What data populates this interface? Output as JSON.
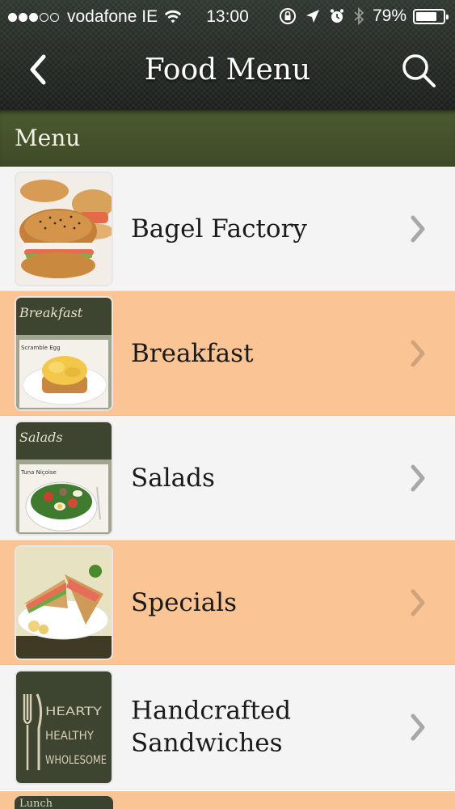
{
  "status_bar": {
    "carrier": "vodafone IE",
    "time": "13:00",
    "battery": "79%",
    "battery_level": 0.79
  },
  "nav": {
    "title": "Food Menu"
  },
  "section": {
    "label": "Menu"
  },
  "menu_items": [
    {
      "label": "Bagel Factory",
      "thumb_text": "",
      "bg": "#f4f4f4"
    },
    {
      "label": "Breakfast",
      "thumb_text": "Breakfast",
      "thumb_subtext": "Scramble Egg",
      "bg": "#fbc494"
    },
    {
      "label": "Salads",
      "thumb_text": "Salads",
      "thumb_subtext": "Tuna Niçoise",
      "bg": "#f4f4f4"
    },
    {
      "label": "Specials",
      "thumb_text": "",
      "bg": "#fbc494"
    },
    {
      "label": "Handcrafted Sandwiches",
      "thumb_text": "HEARTY HEALTHY WHOLESOME",
      "bg": "#f4f4f4"
    }
  ],
  "partial_item": {
    "thumb_text": "Lunch Sandwiches"
  },
  "colors": {
    "header": "#252a25",
    "section_bar": "#4c5a31",
    "row_white": "#f4f4f4",
    "row_peach": "#fbc494",
    "chevron": "#a8a8a8"
  },
  "icons": {
    "back": "chevron-left-icon",
    "search": "search-icon",
    "row_chevron": "chevron-right-icon"
  }
}
